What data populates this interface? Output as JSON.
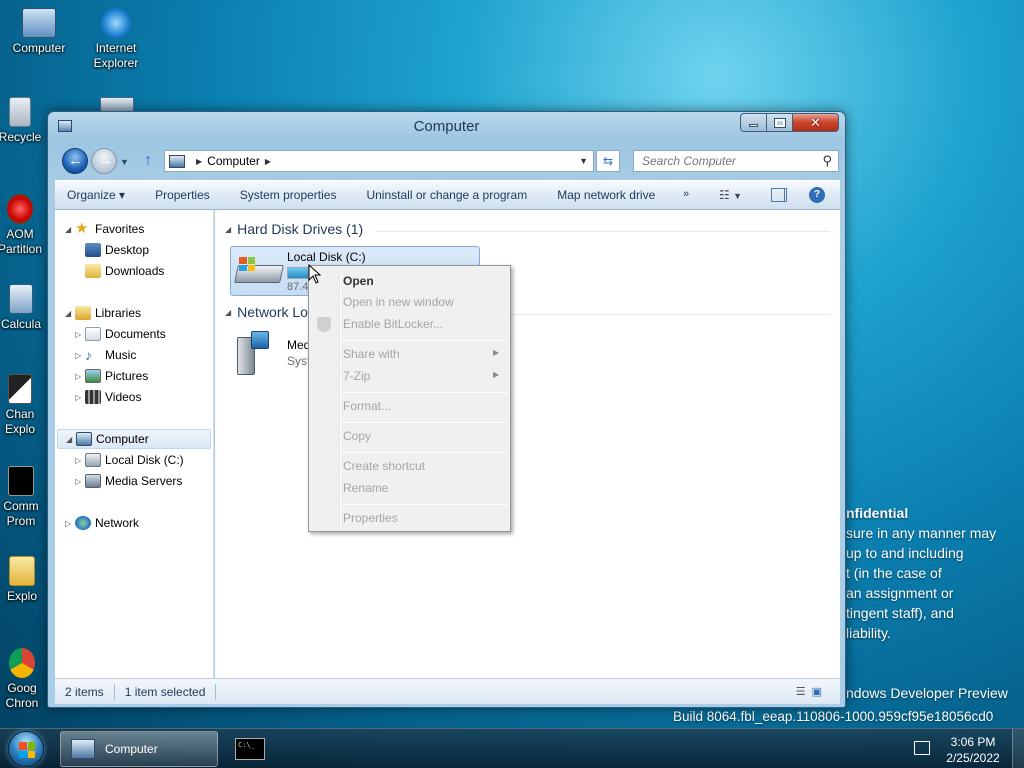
{
  "desktop": {
    "icons": [
      {
        "label": "Computer"
      },
      {
        "label": "Internet Explorer"
      },
      {
        "label": "Recycle"
      },
      {
        "label": "AOM Partition"
      },
      {
        "label": "Calcula"
      },
      {
        "label": "Chan Explo"
      },
      {
        "label": "Comm Prom"
      },
      {
        "label": "Explo"
      },
      {
        "label": "Goog Chron"
      }
    ],
    "watermark": {
      "line1": "nfidential",
      "line2": "sure in any manner may",
      "line3": "up to and including",
      "line4": "t (in the case of",
      "line5": "an assignment or",
      "line6": "tingent staff), and",
      "line7": "liability.",
      "line8": "ndows Developer Preview",
      "line9": "Build 8064.fbl_eeap.110806-1000.959cf95e18056cd0"
    }
  },
  "window": {
    "title": "Computer",
    "address": {
      "crumb": "Computer"
    },
    "search": {
      "placeholder": "Search Computer"
    },
    "toolbar": {
      "organize": "Organize ▾",
      "properties": "Properties",
      "system_properties": "System properties",
      "uninstall": "Uninstall or change a program",
      "map_drive": "Map network drive",
      "more": "»"
    },
    "nav": {
      "favorites": "Favorites",
      "desktop": "Desktop",
      "downloads": "Downloads",
      "libraries": "Libraries",
      "documents": "Documents",
      "music": "Music",
      "pictures": "Pictures",
      "videos": "Videos",
      "computer": "Computer",
      "local_disk": "Local Disk (C:)",
      "media_servers": "Media Servers",
      "network": "Network"
    },
    "content": {
      "hdd_group": "Hard Disk Drives (1)",
      "net_group": "Network Location (1)",
      "drive": {
        "name": "Local Disk (C:)",
        "free_text": "87.4 GB free of 99.6 GB",
        "used_fraction": 0.12
      },
      "media": {
        "name": "Media Servers",
        "sub": "System Folder"
      }
    },
    "status": {
      "items": "2 items",
      "selected": "1 item selected"
    }
  },
  "context_menu": {
    "open": "Open",
    "open_new_window": "Open in new window",
    "bitlocker": "Enable BitLocker...",
    "share_with": "Share with",
    "seven_zip": "7-Zip",
    "format": "Format...",
    "copy": "Copy",
    "create_shortcut": "Create shortcut",
    "rename": "Rename",
    "properties": "Properties"
  },
  "taskbar": {
    "explorer_label": "Computer",
    "cmd_glyph": "C:\\_",
    "time": "3:06 PM",
    "date": "2/25/2022"
  },
  "colors": {
    "accent": "#2d74c8",
    "selection": "#c5dcf3",
    "drive_bar": "#2a8cc5"
  }
}
